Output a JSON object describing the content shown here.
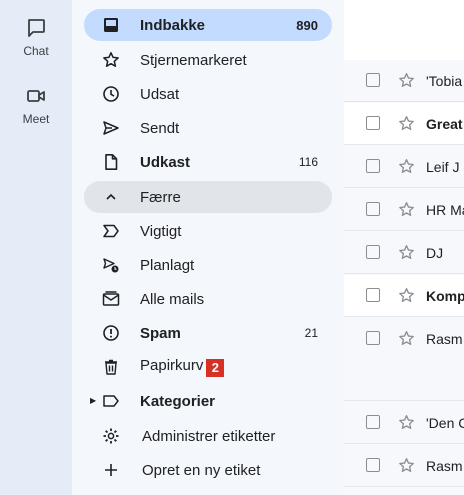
{
  "rail": {
    "items": [
      {
        "label": "Chat",
        "icon": "chat-icon"
      },
      {
        "label": "Meet",
        "icon": "video-icon"
      }
    ]
  },
  "nav": {
    "items": [
      {
        "label": "Indbakke",
        "count": "890",
        "icon": "inbox-icon",
        "active": true
      },
      {
        "label": "Stjernemarkeret",
        "icon": "star-icon"
      },
      {
        "label": "Udsat",
        "icon": "clock-icon"
      },
      {
        "label": "Sendt",
        "icon": "send-icon"
      },
      {
        "label": "Udkast",
        "count": "116",
        "icon": "draft-icon"
      },
      {
        "label": "Færre",
        "icon": "chevron-up-icon"
      },
      {
        "label": "Vigtigt",
        "icon": "important-icon"
      },
      {
        "label": "Planlagt",
        "icon": "scheduled-icon"
      },
      {
        "label": "Alle mails",
        "icon": "all-mail-icon"
      },
      {
        "label": "Spam",
        "count": "21",
        "icon": "spam-icon"
      },
      {
        "label": "Papirkurv",
        "badge": "2",
        "icon": "trash-icon"
      },
      {
        "label": "Kategorier",
        "icon": "label-icon"
      },
      {
        "label": "Administrer etiketter",
        "icon": "gear-icon"
      },
      {
        "label": "Opret en ny etiket",
        "icon": "plus-icon"
      }
    ]
  },
  "messages": [
    {
      "sender": "'Tobia",
      "unread": false
    },
    {
      "sender": "Great",
      "unread": true
    },
    {
      "sender": "Leif J",
      "unread": false
    },
    {
      "sender": "HR Ma",
      "unread": false
    },
    {
      "sender": "DJ",
      "unread": false
    },
    {
      "sender": "Komp",
      "unread": true
    },
    {
      "sender": "Rasm",
      "unread": false
    },
    {
      "sender": "'Den C",
      "unread": false
    },
    {
      "sender": "Rasm",
      "unread": false
    }
  ],
  "colors": {
    "accent_active": "#c2dbff",
    "badge": "#d93025",
    "nav_bg": "#f4f7fc"
  }
}
